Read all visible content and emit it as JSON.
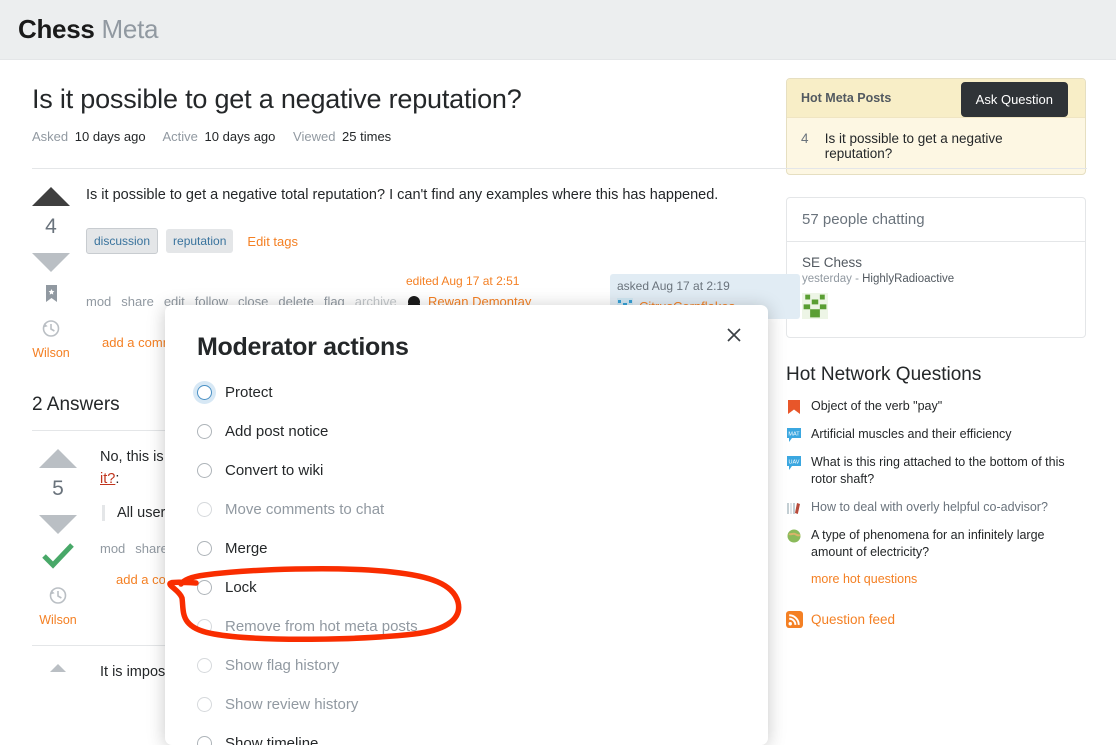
{
  "header": {
    "site_name": "Chess",
    "site_sub": "Meta"
  },
  "question": {
    "title": "Is it possible to get a negative reputation?",
    "stats": [
      {
        "label": "Asked",
        "value": "10 days ago"
      },
      {
        "label": "Active",
        "value": "10 days ago"
      },
      {
        "label": "Viewed",
        "value": "25 times"
      }
    ],
    "ask_button": "Ask Question",
    "score": "4",
    "body": "Is it possible to get a negative total reputation? I can't find any examples where this has happened.",
    "tags": [
      "discussion",
      "reputation"
    ],
    "edit_tags": "Edit tags",
    "actions": [
      "mod",
      "share",
      "edit",
      "follow",
      "close",
      "delete",
      "flag"
    ],
    "actions_disabled": [
      "archive"
    ],
    "owner_badge": "Wilson",
    "edited": {
      "when": "edited Aug 17 at 2:51",
      "user": "Rewan Demontay"
    },
    "asked": {
      "when": "asked Aug 17 at 2:19",
      "user": "CitrusCornflakes"
    },
    "add_comment": "add a comment"
  },
  "answers_header": "2 Answers",
  "answer1": {
    "score": "5",
    "text_start": "No, this is n",
    "link_text": "it?",
    "text_after": ":",
    "quote": "All users s",
    "actions": [
      "mod",
      "share"
    ],
    "owner_badge": "Wilson",
    "add_comment": "add a comme"
  },
  "answer2": {
    "text_start": "It is impossi"
  },
  "sidebar": {
    "hot_meta": {
      "header": "Hot Meta Posts",
      "items": [
        {
          "score": "4",
          "title": "Is it possible to get a negative reputation?"
        }
      ]
    },
    "chat": {
      "header": "57 people chatting",
      "room": "SE Chess",
      "ago": "yesterday",
      "separator": "-",
      "user": "HighlyRadioactive"
    },
    "hot_network": {
      "title": "Hot Network Questions",
      "items": [
        {
          "icon": "bookmark-site-icon",
          "icon_color": "#e8562a",
          "text": "Object of the verb \"pay\"",
          "muted": false
        },
        {
          "icon": "mat-site-icon",
          "icon_color": "#3ba7e0",
          "icon_text": "MAT",
          "text": "Artificial muscles and their efficiency",
          "muted": false
        },
        {
          "icon": "uav-site-icon",
          "icon_color": "#3ba7e0",
          "icon_text": "UAV",
          "text": "What is this ring attached to the bottom of this rotor shaft?",
          "muted": false
        },
        {
          "icon": "books-site-icon",
          "icon_color": "#b8c4c9",
          "text": "How to deal with overly helpful co-advisor?",
          "muted": true
        },
        {
          "icon": "globe-site-icon",
          "icon_color": "#8aba5a",
          "text": "A type of phenomena for an infinitely large amount of electricity?",
          "muted": false
        }
      ],
      "more_link": "more hot questions"
    },
    "question_feed": "Question feed"
  },
  "modal": {
    "title": "Moderator actions",
    "close_label": "×",
    "options": [
      {
        "label": "Protect",
        "disabled": false,
        "focused": true
      },
      {
        "label": "Add post notice",
        "disabled": false,
        "focused": false
      },
      {
        "label": "Convert to wiki",
        "disabled": false,
        "focused": false
      },
      {
        "label": "Move comments to chat",
        "disabled": true,
        "focused": false
      },
      {
        "label": "Merge",
        "disabled": false,
        "focused": false
      },
      {
        "label": "Lock",
        "disabled": false,
        "focused": false
      },
      {
        "label": "Remove from hot meta posts",
        "disabled": true,
        "focused": false
      },
      {
        "label": "Show flag history",
        "disabled": true,
        "focused": false
      },
      {
        "label": "Show review history",
        "disabled": true,
        "focused": false
      },
      {
        "label": "Show timeline",
        "disabled": false,
        "focused": false
      }
    ]
  },
  "annotation": {
    "type": "hand-drawn-ellipse",
    "color": "#f92d00",
    "target": "Remove from hot meta posts"
  }
}
